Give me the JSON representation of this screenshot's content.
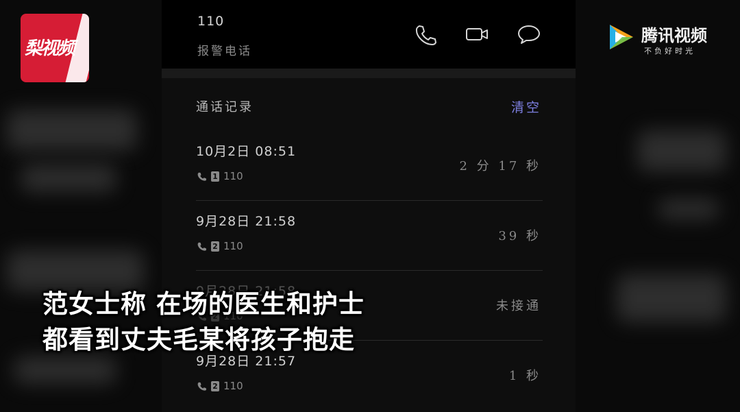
{
  "contact": {
    "number": "110",
    "label": "报警电话"
  },
  "actions": {
    "call_icon": "phone-icon",
    "video_icon": "video-camera-icon",
    "message_icon": "chat-bubble-icon"
  },
  "call_log": {
    "title": "通话记录",
    "clear_label": "清空",
    "entries": [
      {
        "datetime": "10月2日  08:51",
        "sim": "1",
        "number": "110",
        "duration": "2 分 17 秒"
      },
      {
        "datetime": "9月28日  21:58",
        "sim": "2",
        "number": "110",
        "duration": "39 秒"
      },
      {
        "datetime": "9月28日  21:58",
        "sim": "2",
        "number": "110",
        "duration": "未接通"
      },
      {
        "datetime": "9月28日  21:57",
        "sim": "2",
        "number": "110",
        "duration": "1 秒"
      }
    ]
  },
  "branding": {
    "left_logo_text": "梨视频",
    "right_logo_name": "腾讯视频",
    "right_logo_slogan": "不负好时光",
    "left_logo_color": "#d61d35",
    "accent_color": "#7d7fe0"
  },
  "caption": {
    "line1": "范女士称 在场的医生和护士",
    "line2": "都看到丈夫毛某将孩子抱走"
  }
}
